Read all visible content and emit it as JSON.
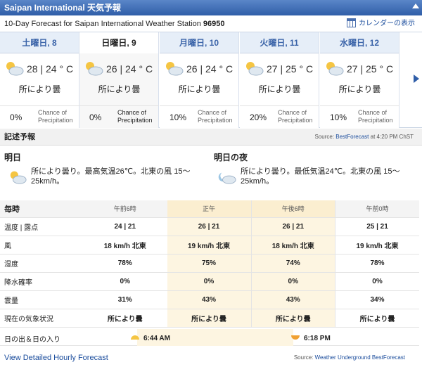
{
  "title": "Saipan International 天気予報",
  "subheader": {
    "text": "10-Day Forecast for Saipan International Weather Station ",
    "station": "96950",
    "calendar_label": "カレンダーの表示"
  },
  "days": [
    {
      "label": "土曜日, 8",
      "temp": "28 | 24 ° C",
      "condition": "所により曇",
      "precip": "0%",
      "precip_label_1": "Chance of",
      "precip_label_2": "Precipitation"
    },
    {
      "label": "日曜日, 9",
      "temp": "26 | 24 ° C",
      "condition": "所により曇",
      "precip": "0%",
      "precip_label_1": "Chance of",
      "precip_label_2": "Precipitation"
    },
    {
      "label": "月曜日, 10",
      "temp": "26 | 24 ° C",
      "condition": "所により曇",
      "precip": "10%",
      "precip_label_1": "Chance of",
      "precip_label_2": "Precipitation"
    },
    {
      "label": "火曜日, 11",
      "temp": "27 | 25 ° C",
      "condition": "所により曇",
      "precip": "20%",
      "precip_label_1": "Chance of",
      "precip_label_2": "Precipitation"
    },
    {
      "label": "水曜日, 12",
      "temp": "27 | 25 ° C",
      "condition": "所により曇",
      "precip": "10%",
      "precip_label_1": "Chance of",
      "precip_label_2": "Precipitation"
    }
  ],
  "narrative": {
    "heading": "記述予報",
    "source_prefix": "Source: ",
    "source_link": "BestForecast",
    "source_suffix": " at 4:20 PM ChST",
    "tomorrow_title": "明日",
    "tomorrow_text": "所により曇り。最高気温26℃。北東の風 15～25km/h。",
    "night_title": "明日の夜",
    "night_text": "所により曇り。最低気温24℃。北東の風 15～25km/h。"
  },
  "hourly": {
    "heading": "毎時",
    "times": [
      "午前6時",
      "正午",
      "午後6時",
      "午前0時"
    ],
    "rows": [
      {
        "label": "温度 | 露点",
        "values": [
          "24 | 21",
          "26 | 21",
          "26 | 21",
          "25 | 21"
        ]
      },
      {
        "label": "風",
        "values": [
          "18 km/h 北東",
          "19 km/h 北東",
          "18 km/h 北東",
          "19 km/h 北東"
        ]
      },
      {
        "label": "湿度",
        "values": [
          "78%",
          "75%",
          "74%",
          "78%"
        ]
      },
      {
        "label": "降水確率",
        "values": [
          "0%",
          "0%",
          "0%",
          "0%"
        ]
      },
      {
        "label": "雲量",
        "values": [
          "31%",
          "43%",
          "43%",
          "34%"
        ]
      },
      {
        "label": "現在の気象状況",
        "values": [
          "所により曇",
          "所により曇",
          "所により曇",
          "所により曇"
        ]
      }
    ],
    "sun_label": "日の出＆日の入り",
    "sunrise": "6:44 AM",
    "sunset": "6:18 PM"
  },
  "footer": {
    "link": "View Detailed Hourly Forecast",
    "source_prefix": "Source: ",
    "source_link": "Weather Underground BestForecast"
  },
  "colors": {
    "accent": "#2f5ea8",
    "highlight": "#fdf5e1",
    "link": "#1a4c9c"
  }
}
